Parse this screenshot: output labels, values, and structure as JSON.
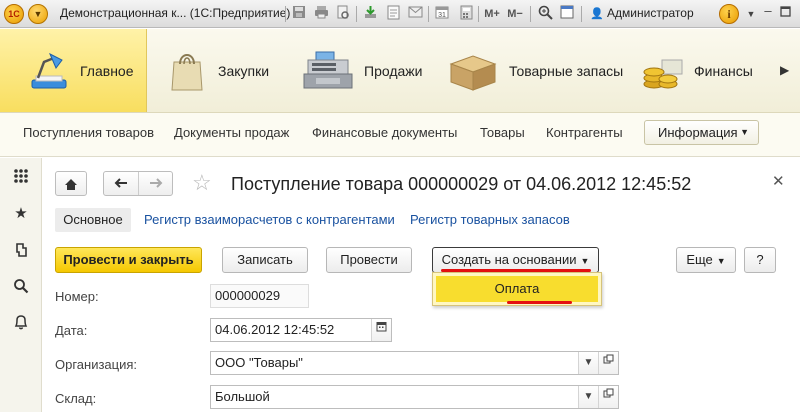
{
  "window": {
    "title": "Демонстрационная к... (1С:Предприятие)",
    "user": "Администратор",
    "logo_text": "1С"
  },
  "sections": [
    {
      "label": "Главное",
      "icon": "desk-lamp-icon",
      "active": true
    },
    {
      "label": "Закупки",
      "icon": "shopping-bag-icon",
      "active": false
    },
    {
      "label": "Продажи",
      "icon": "cash-register-icon",
      "active": false
    },
    {
      "label": "Товарные запасы",
      "icon": "box-icon",
      "active": false
    },
    {
      "label": "Финансы",
      "icon": "coins-icon",
      "active": false
    }
  ],
  "nav": {
    "links": [
      "Поступления товаров",
      "Документы продаж",
      "Финансовые документы",
      "Товары",
      "Контрагенты"
    ],
    "info_button": "Информация"
  },
  "document": {
    "title": "Поступление товара 000000029 от 04.06.2012 12:45:52",
    "tabs": {
      "main": "Основное",
      "link1": "Регистр взаиморасчетов с контрагентами",
      "link2": "Регистр товарных запасов"
    },
    "buttons": {
      "post_close": "Провести и закрыть",
      "save": "Записать",
      "post": "Провести",
      "create_based": "Создать на основании",
      "more": "Еще",
      "help": "?"
    },
    "dropdown": {
      "item": "Оплата"
    },
    "fields": {
      "number_label": "Номер:",
      "number_value": "000000029",
      "date_label": "Дата:",
      "date_value": "04.06.2012 12:45:52",
      "org_label": "Организация:",
      "org_value": "ООО \"Товары\"",
      "warehouse_label": "Склад:",
      "warehouse_value": "Большой"
    }
  },
  "colors": {
    "accent_yellow": "#f8dd2e",
    "highlight_red": "#e41010",
    "link_blue": "#1a52a0"
  }
}
